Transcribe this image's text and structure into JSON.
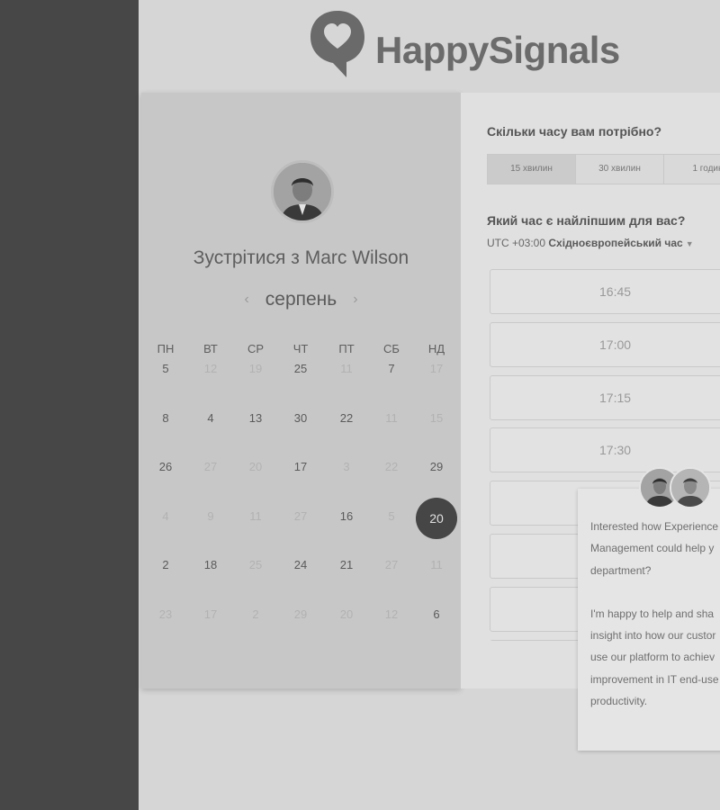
{
  "logo": {
    "text": "HappySignals"
  },
  "host": {
    "title": "Зустрітися з Marc Wilson"
  },
  "calendar": {
    "month": "серпень",
    "prev_icon": "chevron-left-icon",
    "next_icon": "chevron-right-icon",
    "weekdays": [
      "ПН",
      "ВТ",
      "СР",
      "ЧТ",
      "ПТ",
      "СБ",
      "НД"
    ],
    "weeks": [
      [
        {
          "d": "5",
          "s": "active"
        },
        {
          "d": "12",
          "s": "inactive"
        },
        {
          "d": "19",
          "s": "inactive"
        },
        {
          "d": "25",
          "s": "active"
        },
        {
          "d": "11",
          "s": "inactive"
        },
        {
          "d": "7",
          "s": "active"
        },
        {
          "d": "17",
          "s": "inactive"
        }
      ],
      [
        {
          "d": "8",
          "s": "active"
        },
        {
          "d": "4",
          "s": "active"
        },
        {
          "d": "13",
          "s": "active"
        },
        {
          "d": "30",
          "s": "active"
        },
        {
          "d": "22",
          "s": "active"
        },
        {
          "d": "11",
          "s": "inactive"
        },
        {
          "d": "15",
          "s": "inactive"
        }
      ],
      [
        {
          "d": "26",
          "s": "active"
        },
        {
          "d": "27",
          "s": "inactive"
        },
        {
          "d": "20",
          "s": "inactive"
        },
        {
          "d": "17",
          "s": "active"
        },
        {
          "d": "3",
          "s": "inactive"
        },
        {
          "d": "22",
          "s": "inactive"
        },
        {
          "d": "29",
          "s": "active"
        }
      ],
      [
        {
          "d": "4",
          "s": "inactive"
        },
        {
          "d": "9",
          "s": "inactive"
        },
        {
          "d": "11",
          "s": "inactive"
        },
        {
          "d": "27",
          "s": "inactive"
        },
        {
          "d": "16",
          "s": "active"
        },
        {
          "d": "5",
          "s": "inactive"
        },
        {
          "d": "20",
          "s": "selected"
        }
      ],
      [
        {
          "d": "2",
          "s": "active"
        },
        {
          "d": "18",
          "s": "active"
        },
        {
          "d": "25",
          "s": "inactive"
        },
        {
          "d": "24",
          "s": "active"
        },
        {
          "d": "21",
          "s": "active"
        },
        {
          "d": "27",
          "s": "inactive"
        },
        {
          "d": "11",
          "s": "inactive"
        }
      ],
      [
        {
          "d": "23",
          "s": "inactive"
        },
        {
          "d": "17",
          "s": "inactive"
        },
        {
          "d": "2",
          "s": "inactive"
        },
        {
          "d": "29",
          "s": "inactive"
        },
        {
          "d": "20",
          "s": "inactive"
        },
        {
          "d": "12",
          "s": "inactive"
        },
        {
          "d": "6",
          "s": "active"
        }
      ]
    ]
  },
  "booking": {
    "duration_question": "Скільки часу вам потрібно?",
    "durations": [
      "15 хвилин",
      "30 хвилин",
      "1 годин"
    ],
    "selected_duration": "15 хвилин",
    "time_question": "Який час є найліпшим для вас?",
    "tz_offset": "UTC +03:00",
    "tz_name": "Східноєвропейський час",
    "slots": [
      "16:45",
      "17:00",
      "17:15",
      "17:30",
      "",
      "",
      "",
      ""
    ]
  },
  "chat": {
    "lines_1": [
      "Interested how Experience",
      "Management could help y",
      "department?"
    ],
    "lines_2": [
      "I'm happy to help and sha",
      "insight into how our custor",
      "use our platform to achiev",
      "improvement in IT end-use",
      "productivity."
    ]
  }
}
